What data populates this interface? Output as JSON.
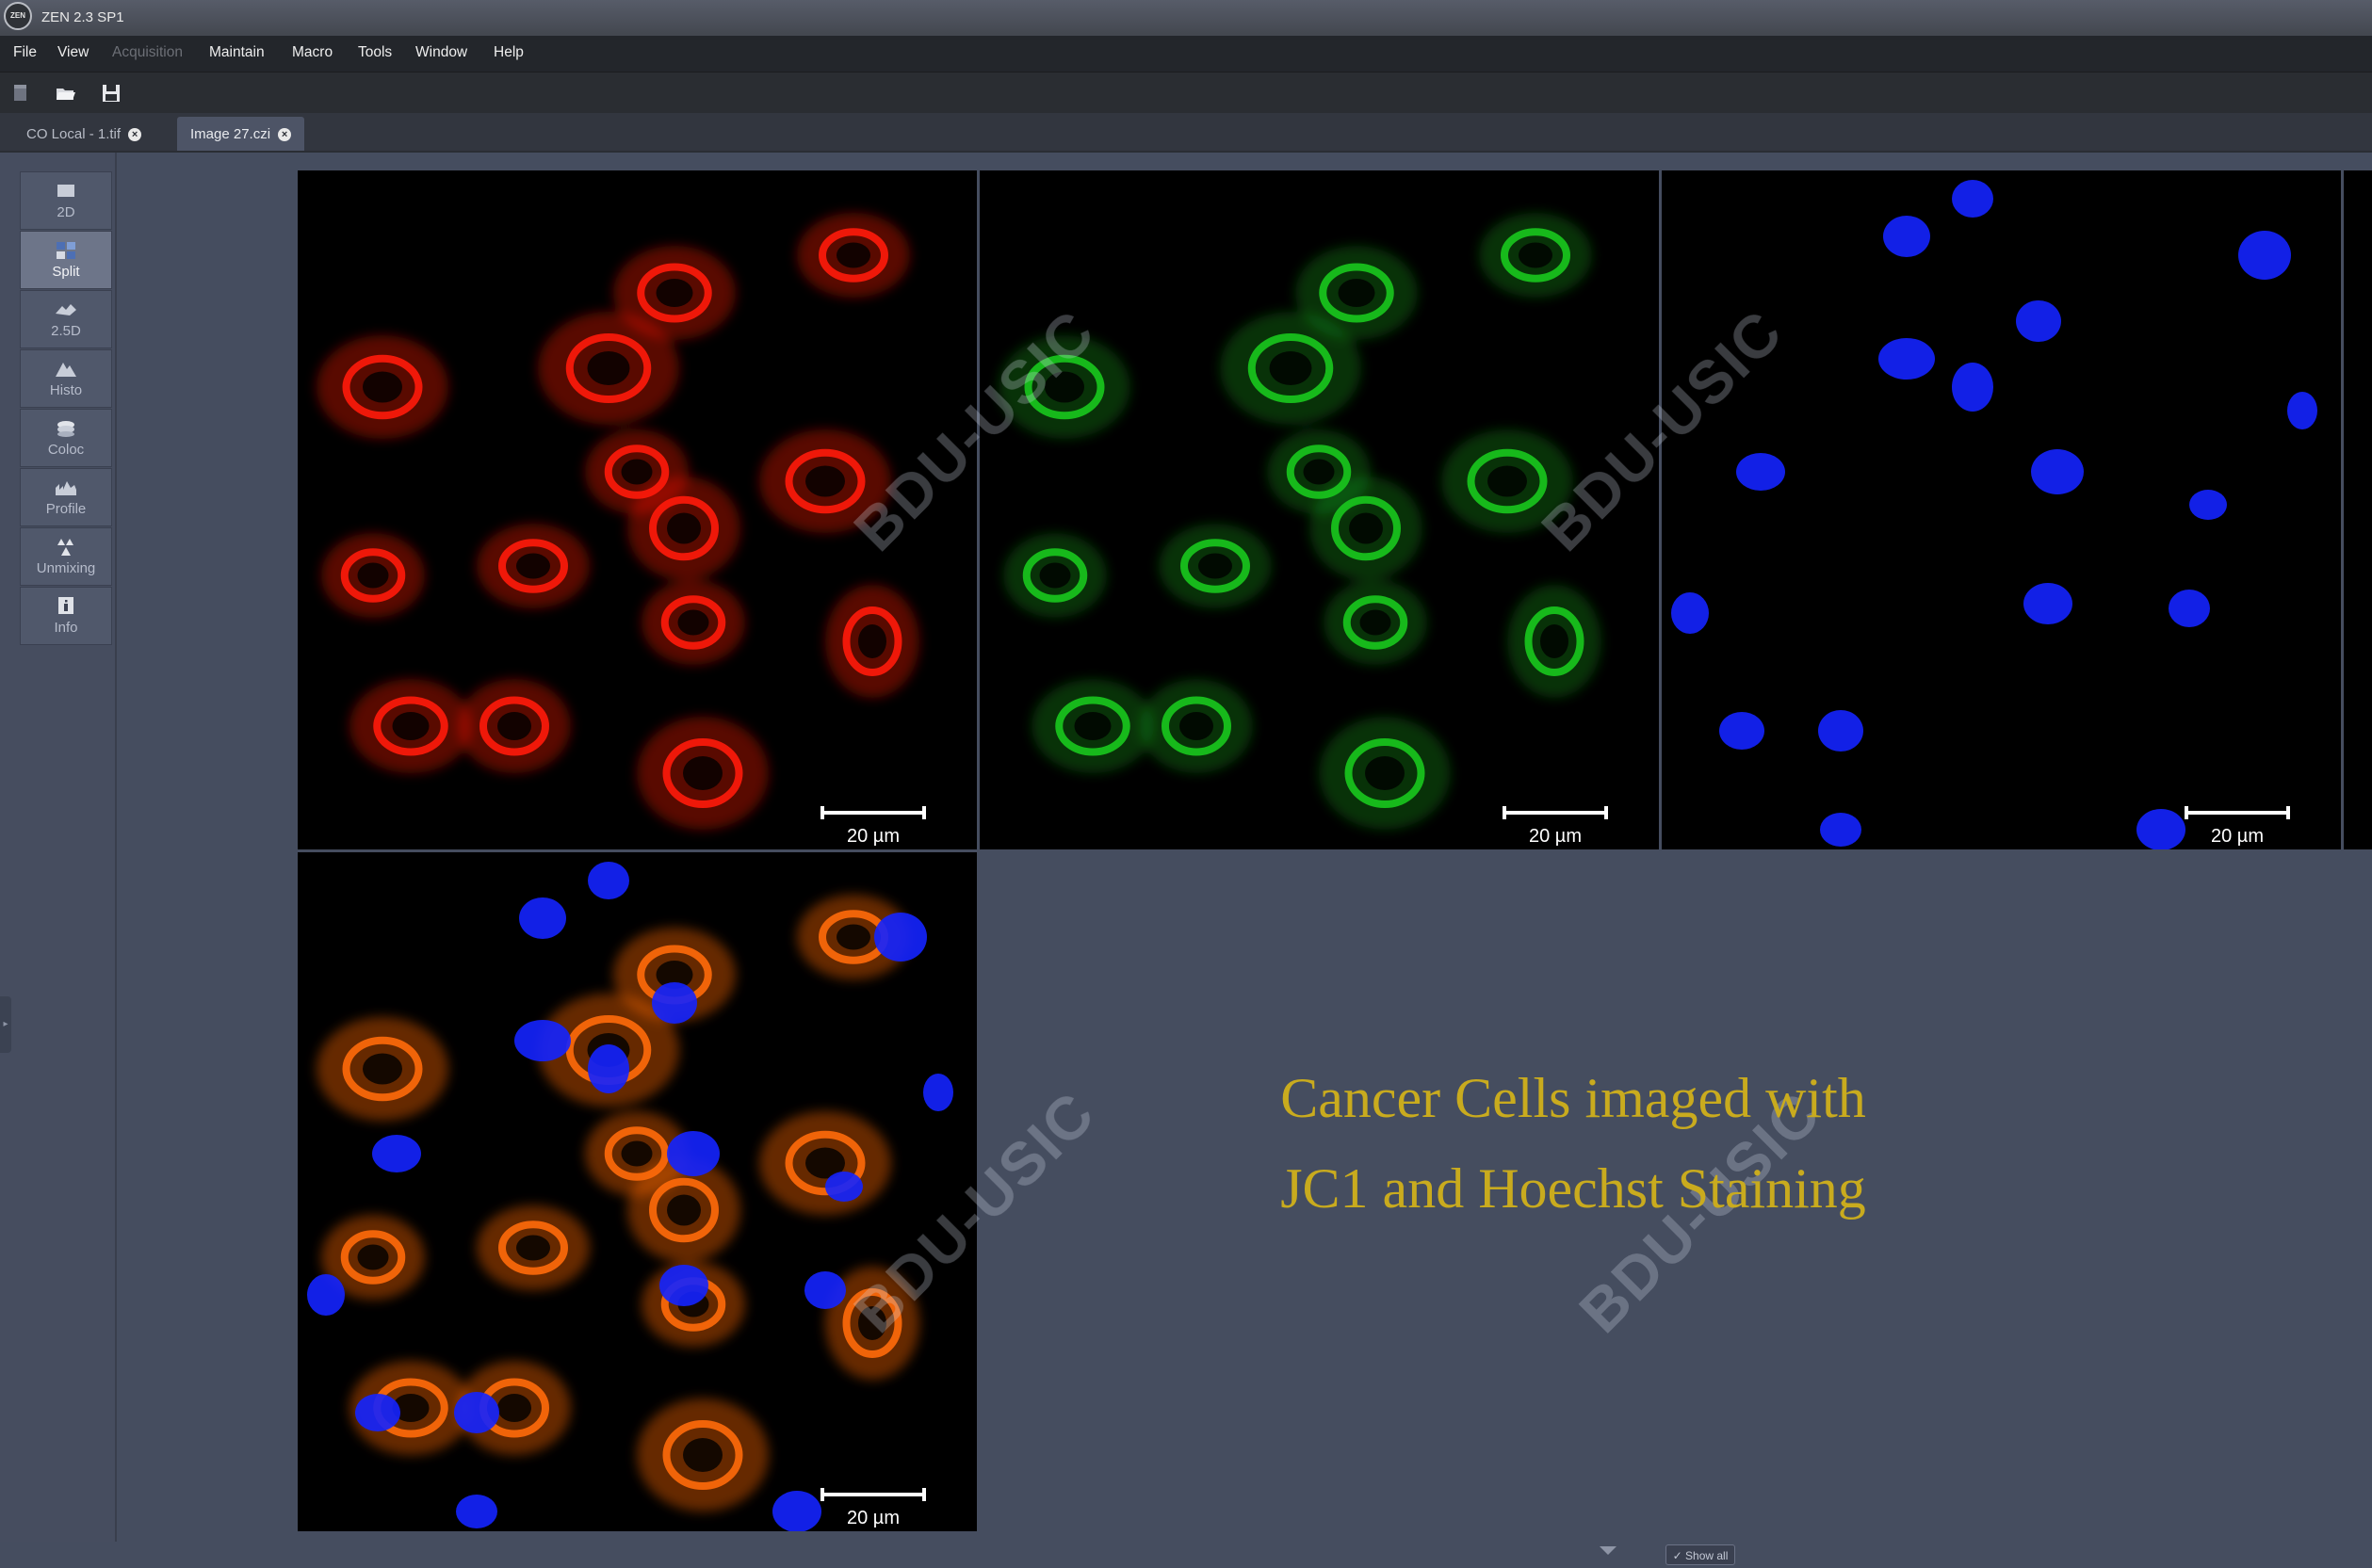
{
  "window": {
    "logo_text": "ZEN",
    "title": "ZEN 2.3 SP1"
  },
  "menu": [
    {
      "label": "File",
      "enabled": true
    },
    {
      "label": "View",
      "enabled": true
    },
    {
      "label": "Acquisition",
      "enabled": false
    },
    {
      "label": "Maintain",
      "enabled": true
    },
    {
      "label": "Macro",
      "enabled": true
    },
    {
      "label": "Tools",
      "enabled": true
    },
    {
      "label": "Window",
      "enabled": true
    },
    {
      "label": "Help",
      "enabled": true
    }
  ],
  "toolbar": {
    "icons": [
      "new-document-icon",
      "open-folder-icon",
      "save-icon"
    ]
  },
  "tabs": [
    {
      "label": "CO Local - 1.tif",
      "active": false
    },
    {
      "label": "Image 27.czi",
      "active": true
    }
  ],
  "view_modes": [
    {
      "label": "2D",
      "icon": "2d-icon"
    },
    {
      "label": "Split",
      "icon": "split-icon",
      "active": true
    },
    {
      "label": "2.5D",
      "icon": "2-5d-icon"
    },
    {
      "label": "Histo",
      "icon": "histogram-icon"
    },
    {
      "label": "Coloc",
      "icon": "coloc-icon"
    },
    {
      "label": "Profile",
      "icon": "profile-icon"
    },
    {
      "label": "Unmixing",
      "icon": "unmixing-icon"
    },
    {
      "label": "Info",
      "icon": "info-icon"
    }
  ],
  "panels": [
    {
      "channel": "red",
      "scale_label": "20 µm"
    },
    {
      "channel": "green",
      "scale_label": "20 µm"
    },
    {
      "channel": "blue",
      "scale_label": "20 µm"
    },
    {
      "channel": "merged",
      "scale_label": "20 µm"
    }
  ],
  "watermark": "BDU-USIC",
  "caption": {
    "line1": "Cancer Cells imaged with",
    "line2": "JC1 and Hoechst Staining"
  },
  "footer": {
    "show_all_label": "Show all"
  },
  "colors": {
    "caption": "#c9ab1e",
    "red_channel": "#ff1a0a",
    "green_channel": "#19c81e",
    "blue_channel": "#1424ff",
    "merged_channel": "#ff6a0a"
  }
}
